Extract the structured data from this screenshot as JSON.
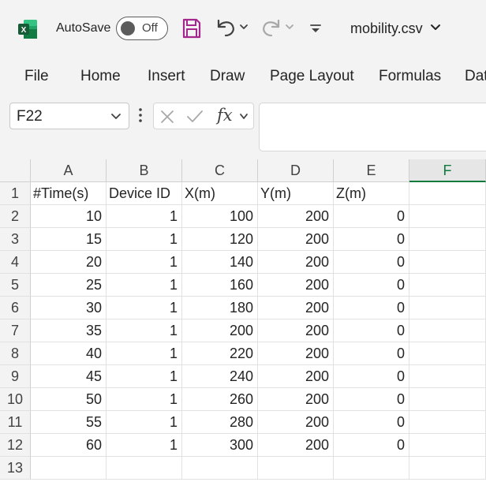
{
  "titlebar": {
    "autosave_label": "AutoSave",
    "autosave_state": "Off",
    "file_name": "mobility.csv",
    "brand_color": "#107c41"
  },
  "ribbon": {
    "tabs": [
      "File",
      "Home",
      "Insert",
      "Draw",
      "Page Layout",
      "Formulas",
      "Dat"
    ]
  },
  "formula_bar": {
    "name_box": "F22",
    "fx_label": "fx",
    "formula_value": ""
  },
  "sheet": {
    "columns": [
      "A",
      "B",
      "C",
      "D",
      "E",
      "F"
    ],
    "selected_column": "F",
    "rows": [
      [
        "#Time(s)",
        "Device ID",
        "X(m)",
        "Y(m)",
        "Z(m)",
        ""
      ],
      [
        "10",
        "1",
        "100",
        "200",
        "0",
        ""
      ],
      [
        "15",
        "1",
        "120",
        "200",
        "0",
        ""
      ],
      [
        "20",
        "1",
        "140",
        "200",
        "0",
        ""
      ],
      [
        "25",
        "1",
        "160",
        "200",
        "0",
        ""
      ],
      [
        "30",
        "1",
        "180",
        "200",
        "0",
        ""
      ],
      [
        "35",
        "1",
        "200",
        "200",
        "0",
        ""
      ],
      [
        "40",
        "1",
        "220",
        "200",
        "0",
        ""
      ],
      [
        "45",
        "1",
        "240",
        "200",
        "0",
        ""
      ],
      [
        "50",
        "1",
        "260",
        "200",
        "0",
        ""
      ],
      [
        "55",
        "1",
        "280",
        "200",
        "0",
        ""
      ],
      [
        "60",
        "1",
        "300",
        "200",
        "0",
        ""
      ],
      [
        "",
        "",
        "",
        "",
        "",
        ""
      ]
    ],
    "row_numbers": [
      "1",
      "2",
      "3",
      "4",
      "5",
      "6",
      "7",
      "8",
      "9",
      "10",
      "11",
      "12",
      "13"
    ]
  }
}
